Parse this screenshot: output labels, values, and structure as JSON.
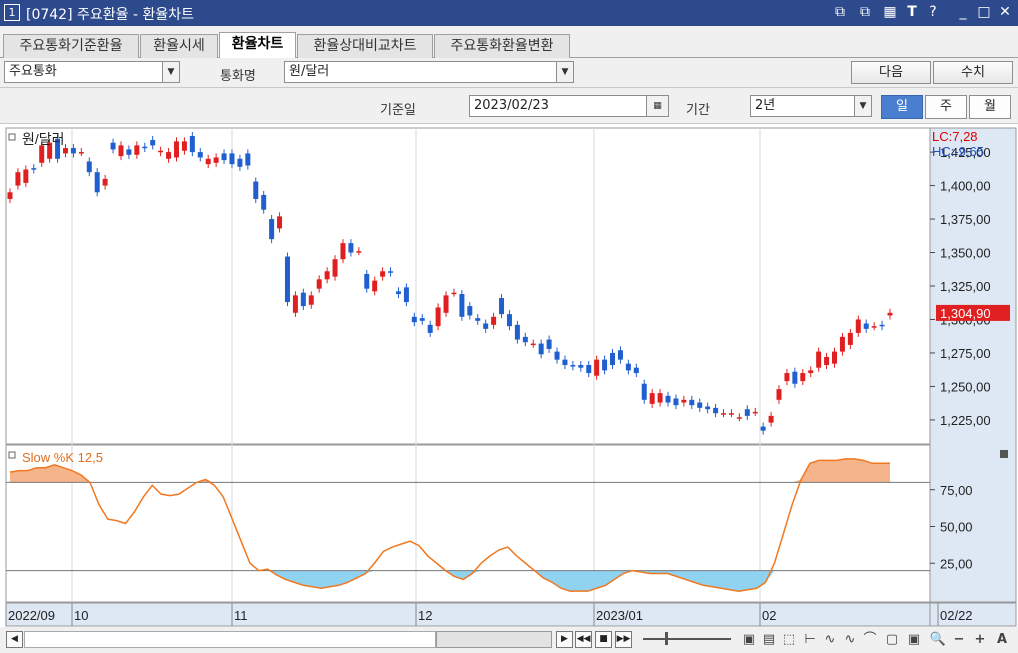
{
  "window": {
    "num": "1",
    "title": "[0742] 주요환율 - 환율차트",
    "buttons": [
      "⧉",
      "⧉",
      "▦",
      "T",
      "?",
      "_",
      "□",
      "✕"
    ]
  },
  "tabs": [
    "주요통화기준환율",
    "환율시세",
    "환율차트",
    "환율상대비교차트",
    "주요통화환율변환"
  ],
  "active_tab": 2,
  "controls": {
    "currency_group": "주요통화",
    "currency_label": "통화명",
    "currency": "원/달러",
    "next_btn": "다음",
    "query_btn": "수치",
    "date_label": "기준일",
    "date": "2023/02/23",
    "period_label": "기간",
    "period": "2년",
    "freq": [
      "일",
      "주",
      "월"
    ],
    "freq_active": 0
  },
  "chart_data": {
    "type": "candlestick",
    "title": "원/달러",
    "lc_label": "LC:7,28",
    "hc_label": "HC:-9,65",
    "current_label": "1,304,90",
    "current_value": 1304.9,
    "ylim": [
      1210,
      1440
    ],
    "yticks": [
      1425,
      1400,
      1375,
      1350,
      1325,
      1300,
      1275,
      1250,
      1225
    ],
    "ytick_labels": [
      "1,425,00",
      "1,400,00",
      "1,375,00",
      "1,350,00",
      "1,325,00",
      "1,300,00",
      "1,275,00",
      "1,250,00",
      "1,225,00"
    ],
    "x_labels": [
      "2022/09",
      "10",
      "11",
      "12",
      "2023/01",
      "02",
      "02/22"
    ],
    "candles": [
      {
        "o": 1390,
        "c": 1395
      },
      {
        "o": 1400,
        "c": 1410
      },
      {
        "o": 1402,
        "c": 1412
      },
      {
        "o": 1413,
        "c": 1412
      },
      {
        "o": 1417,
        "c": 1430
      },
      {
        "o": 1420,
        "c": 1432
      },
      {
        "o": 1435,
        "c": 1420
      },
      {
        "o": 1424,
        "c": 1428
      },
      {
        "o": 1428,
        "c": 1424
      },
      {
        "o": 1425,
        "c": 1425
      },
      {
        "o": 1418,
        "c": 1410
      },
      {
        "o": 1410,
        "c": 1395
      },
      {
        "o": 1400,
        "c": 1405
      },
      {
        "o": 1432,
        "c": 1427
      },
      {
        "o": 1422,
        "c": 1430
      },
      {
        "o": 1427,
        "c": 1423
      },
      {
        "o": 1423,
        "c": 1430
      },
      {
        "o": 1429,
        "c": 1428
      },
      {
        "o": 1434,
        "c": 1430
      },
      {
        "o": 1425,
        "c": 1426
      },
      {
        "o": 1420,
        "c": 1425
      },
      {
        "o": 1421,
        "c": 1433
      },
      {
        "o": 1426,
        "c": 1433
      },
      {
        "o": 1437,
        "c": 1425
      },
      {
        "o": 1425,
        "c": 1421
      },
      {
        "o": 1416,
        "c": 1420
      },
      {
        "o": 1417,
        "c": 1421
      },
      {
        "o": 1424,
        "c": 1419
      },
      {
        "o": 1424,
        "c": 1416
      },
      {
        "o": 1420,
        "c": 1414
      },
      {
        "o": 1424,
        "c": 1415
      },
      {
        "o": 1403,
        "c": 1390
      },
      {
        "o": 1393,
        "c": 1382
      },
      {
        "o": 1375,
        "c": 1360
      },
      {
        "o": 1368,
        "c": 1377
      },
      {
        "o": 1347,
        "c": 1313
      },
      {
        "o": 1305,
        "c": 1318
      },
      {
        "o": 1320,
        "c": 1310
      },
      {
        "o": 1311,
        "c": 1318
      },
      {
        "o": 1323,
        "c": 1330
      },
      {
        "o": 1330,
        "c": 1336
      },
      {
        "o": 1332,
        "c": 1345
      },
      {
        "o": 1345,
        "c": 1357
      },
      {
        "o": 1357,
        "c": 1350
      },
      {
        "o": 1351,
        "c": 1351
      },
      {
        "o": 1334,
        "c": 1323
      },
      {
        "o": 1321,
        "c": 1329
      },
      {
        "o": 1332,
        "c": 1336
      },
      {
        "o": 1336,
        "c": 1335
      },
      {
        "o": 1321,
        "c": 1319
      },
      {
        "o": 1324,
        "c": 1313
      },
      {
        "o": 1302,
        "c": 1298
      },
      {
        "o": 1301,
        "c": 1299
      },
      {
        "o": 1296,
        "c": 1290
      },
      {
        "o": 1295,
        "c": 1309
      },
      {
        "o": 1305,
        "c": 1318
      },
      {
        "o": 1320,
        "c": 1320
      },
      {
        "o": 1319,
        "c": 1302
      },
      {
        "o": 1310,
        "c": 1303
      },
      {
        "o": 1301,
        "c": 1299
      },
      {
        "o": 1297,
        "c": 1293
      },
      {
        "o": 1296,
        "c": 1302
      },
      {
        "o": 1316,
        "c": 1304
      },
      {
        "o": 1304,
        "c": 1295
      },
      {
        "o": 1296,
        "c": 1285
      },
      {
        "o": 1287,
        "c": 1283
      },
      {
        "o": 1282,
        "c": 1282
      },
      {
        "o": 1282,
        "c": 1274
      },
      {
        "o": 1285,
        "c": 1278
      },
      {
        "o": 1276,
        "c": 1270
      },
      {
        "o": 1270,
        "c": 1266
      },
      {
        "o": 1266,
        "c": 1265
      },
      {
        "o": 1266,
        "c": 1264
      },
      {
        "o": 1266,
        "c": 1260
      },
      {
        "o": 1258,
        "c": 1270
      },
      {
        "o": 1270,
        "c": 1262
      },
      {
        "o": 1275,
        "c": 1266
      },
      {
        "o": 1277,
        "c": 1270
      },
      {
        "o": 1267,
        "c": 1262
      },
      {
        "o": 1264,
        "c": 1260
      },
      {
        "o": 1252,
        "c": 1240
      },
      {
        "o": 1237,
        "c": 1245
      },
      {
        "o": 1238,
        "c": 1245
      },
      {
        "o": 1243,
        "c": 1238
      },
      {
        "o": 1241,
        "c": 1236
      },
      {
        "o": 1238,
        "c": 1240
      },
      {
        "o": 1240,
        "c": 1236
      },
      {
        "o": 1238,
        "c": 1234
      },
      {
        "o": 1235,
        "c": 1233
      },
      {
        "o": 1234,
        "c": 1230
      },
      {
        "o": 1230,
        "c": 1230
      },
      {
        "o": 1230,
        "c": 1230
      },
      {
        "o": 1227,
        "c": 1227
      },
      {
        "o": 1233,
        "c": 1228
      },
      {
        "o": 1231,
        "c": 1231
      },
      {
        "o": 1220,
        "c": 1217
      },
      {
        "o": 1223,
        "c": 1228
      },
      {
        "o": 1240,
        "c": 1248
      },
      {
        "o": 1254,
        "c": 1260
      },
      {
        "o": 1261,
        "c": 1252
      },
      {
        "o": 1254,
        "c": 1260
      },
      {
        "o": 1260,
        "c": 1262
      },
      {
        "o": 1264,
        "c": 1276
      },
      {
        "o": 1266,
        "c": 1272
      },
      {
        "o": 1267,
        "c": 1276
      },
      {
        "o": 1276,
        "c": 1287
      },
      {
        "o": 1281,
        "c": 1290
      },
      {
        "o": 1290,
        "c": 1300
      },
      {
        "o": 1297,
        "c": 1293
      },
      {
        "o": 1295,
        "c": 1295
      },
      {
        "o": 1296,
        "c": 1295
      },
      {
        "o": 1303,
        "c": 1305
      }
    ],
    "oscillator": {
      "label": "Slow %K 12,5",
      "ylim": [
        0,
        100
      ],
      "upper": 80,
      "lower": 20,
      "yticks": [
        75,
        50,
        25
      ],
      "ytick_labels": [
        "75,00",
        "50,00",
        "25,00"
      ],
      "values": [
        87,
        88,
        88,
        90,
        90,
        92,
        90,
        88,
        85,
        80,
        65,
        55,
        54,
        52,
        60,
        70,
        78,
        72,
        71,
        72,
        76,
        80,
        82,
        78,
        70,
        55,
        40,
        25,
        20,
        21,
        17,
        14,
        12,
        10,
        9,
        8,
        9,
        10,
        12,
        15,
        18,
        25,
        33,
        36,
        38,
        40,
        37,
        30,
        25,
        20,
        16,
        14,
        18,
        25,
        30,
        34,
        36,
        30,
        25,
        20,
        15,
        12,
        8,
        6,
        6,
        6,
        8,
        10,
        14,
        18,
        20,
        19,
        18,
        18,
        18,
        16,
        14,
        12,
        10,
        9,
        8,
        7,
        6,
        7,
        8,
        12,
        25,
        45,
        65,
        82,
        93,
        95,
        95,
        95,
        96,
        96,
        95,
        93,
        93,
        93
      ]
    }
  },
  "toolbar": {
    "nav": [
      "◀◀",
      "■",
      "▶▶"
    ],
    "tools": [
      "▣",
      "▤",
      "⬚",
      "⊢",
      "∿",
      "∿",
      "⌒",
      "▢",
      "▣",
      "🔍",
      "−",
      "+",
      "A"
    ]
  }
}
